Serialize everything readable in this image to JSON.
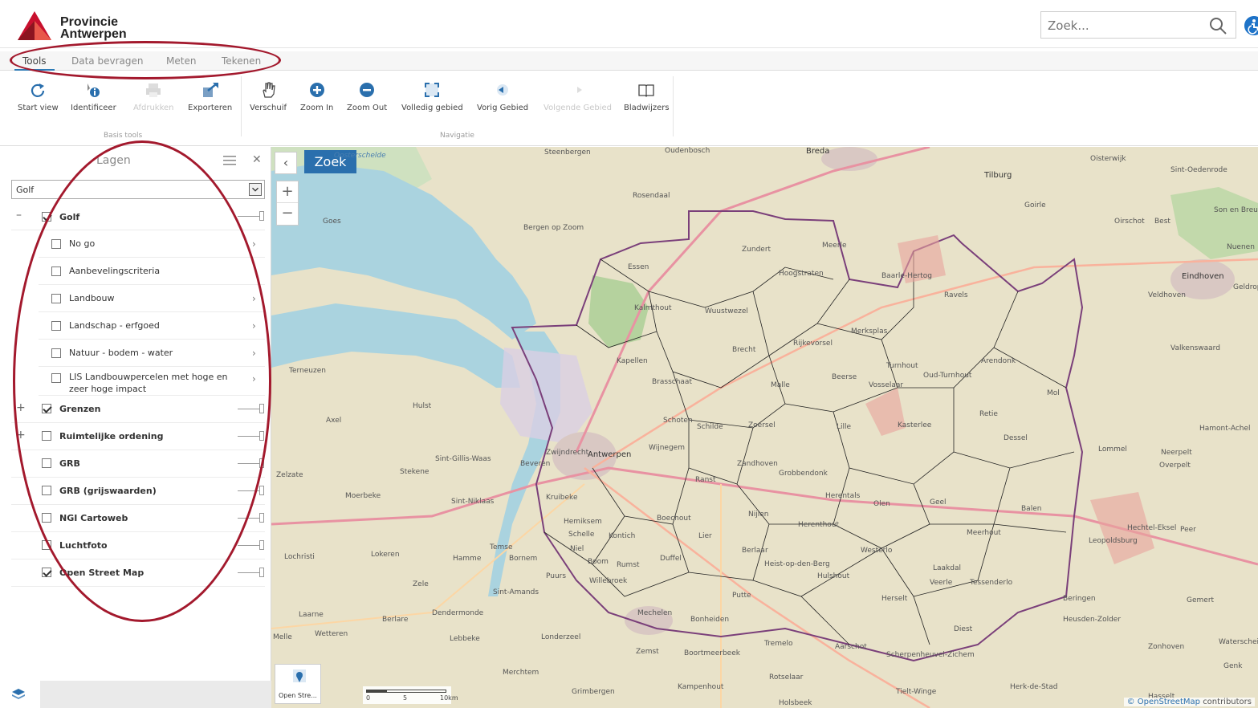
{
  "header": {
    "brand_line1": "Provincie",
    "brand_line2": "Antwerpen",
    "search_placeholder": "Zoek..."
  },
  "tabs": [
    {
      "label": "Tools",
      "active": true
    },
    {
      "label": "Data bevragen",
      "active": false
    },
    {
      "label": "Meten",
      "active": false
    },
    {
      "label": "Tekenen",
      "active": false
    }
  ],
  "toolbar": {
    "basis_tools": [
      {
        "label": "Start view",
        "icon": "refresh-icon",
        "enabled": true
      },
      {
        "label": "Identificeer",
        "icon": "info-icon",
        "enabled": true
      },
      {
        "label": "Afdrukken",
        "icon": "printer-icon",
        "enabled": false
      },
      {
        "label": "Exporteren",
        "icon": "export-icon",
        "enabled": true
      }
    ],
    "basis_tools_label": "Basis tools",
    "navigatie": [
      {
        "label": "Verschuif",
        "icon": "hand-icon",
        "enabled": true
      },
      {
        "label": "Zoom In",
        "icon": "zoom-in-icon",
        "enabled": true
      },
      {
        "label": "Zoom Out",
        "icon": "zoom-out-icon",
        "enabled": true
      },
      {
        "label": "Volledig gebied",
        "icon": "full-extent-icon",
        "enabled": true
      },
      {
        "label": "Vorig Gebied",
        "icon": "back-arrow-icon",
        "enabled": true
      },
      {
        "label": "Volgende Gebied",
        "icon": "forward-arrow-icon",
        "enabled": false
      },
      {
        "label": "Bladwijzers",
        "icon": "book-icon",
        "enabled": true
      }
    ],
    "navigatie_label": "Navigatie"
  },
  "layers_panel": {
    "title": "Lagen",
    "selected_group": "Golf",
    "layers": [
      {
        "label": "Golf",
        "checked": true,
        "expander": "–",
        "bold": true
      },
      {
        "label": "Grenzen",
        "checked": true,
        "expander": "+",
        "bold": true
      },
      {
        "label": "Ruimtelijke ordening",
        "checked": false,
        "expander": "+",
        "bold": true
      },
      {
        "label": "GRB",
        "checked": false,
        "expander": "",
        "bold": true
      },
      {
        "label": "GRB (grijswaarden)",
        "checked": false,
        "expander": "",
        "bold": true
      },
      {
        "label": "NGI Cartoweb",
        "checked": false,
        "expander": "",
        "bold": true
      },
      {
        "label": "Luchtfoto",
        "checked": false,
        "expander": "",
        "bold": true
      },
      {
        "label": "Open Street Map",
        "checked": true,
        "expander": "",
        "bold": true
      }
    ],
    "golf_sublayers": [
      {
        "label": "No go",
        "checked": false
      },
      {
        "label": "Aanbevelingscriteria",
        "checked": false
      },
      {
        "label": "Landbouw",
        "checked": false
      },
      {
        "label": "Landschap - erfgoed",
        "checked": false
      },
      {
        "label": "Natuur - bodem - water",
        "checked": false
      },
      {
        "label": "LIS Landbouwpercelen met hoge en",
        "label2": "zeer hoge impact",
        "checked": false
      }
    ]
  },
  "map": {
    "search_button": "Zoek",
    "basemap_label": "Open Stre...",
    "scale_labels": [
      "0",
      "5",
      "10km"
    ],
    "attribution_link": "© OpenStreetMap",
    "attribution_text": "contributors",
    "place_labels": [
      "Oosterschelde",
      "Steenbergen",
      "Oudenbosch",
      "Breda",
      "Tilburg",
      "Oisterwijk",
      "Goes",
      "Bergen op Zoom",
      "Rosendaal",
      "Zundert",
      "Essen",
      "Hoogstraten",
      "Baarle-Hertog",
      "Ravels",
      "Meerle",
      "Wuustwezel",
      "Kalmthout",
      "Brecht",
      "Rijkevorsel",
      "Merksplas",
      "Turnhout",
      "Oud-Turnhout",
      "Arendonk",
      "Beerse",
      "Vosselaar",
      "Kapellen",
      "Brasschaat",
      "Schoten",
      "Malle",
      "Zoersel",
      "Lille",
      "Kasterlee",
      "Retie",
      "Dessel",
      "Mol",
      "Antwerpen",
      "Zwijndrecht",
      "Wijnegem",
      "Schilde",
      "Ranst",
      "Zandhoven",
      "Grobbendonk",
      "Herentals",
      "Olen",
      "Geel",
      "Balen",
      "Kruibeke",
      "Hemiksem",
      "Boechout",
      "Lier",
      "Nijlen",
      "Herenthout",
      "Meerhout",
      "Schelle",
      "Kontich",
      "Niel",
      "Boom",
      "Rumst",
      "Duffel",
      "Berlaar",
      "Heist-op-den-Berg",
      "Westerlo",
      "Laakdal",
      "Bornem",
      "Puurs",
      "Willebroek",
      "Sint-Amands",
      "Mechelen",
      "Bonheiden",
      "Putte",
      "Hulshout",
      "Herselt",
      "Eindhoven",
      "Veldhoven",
      "Neerpelt",
      "Overpelt",
      "Lommel",
      "Leopoldsburg",
      "Temse",
      "Hamme",
      "Zele",
      "Sint-Niklaas",
      "Beveren",
      "Stekene",
      "Sint-Gillis-Waas",
      "Terneuzen",
      "Hulst",
      "Zelzate",
      "Axel",
      "Moerbeke",
      "Lochristi",
      "Lokeren",
      "Laarne",
      "Berlare",
      "Dendermonde",
      "Wetteren",
      "Melle",
      "Lebbeke",
      "Londerzeel",
      "Merchtem",
      "Grimbergen",
      "Zemst",
      "Boortmeerbeek",
      "Tremelo",
      "Aarschot",
      "Rotselaar",
      "Scherpenheuvel-Zichem",
      "Diest",
      "Herk-de-Stad",
      "Tielt-Winge",
      "Holsbeek",
      "Kampenhout",
      "Veerle",
      "Tessenderlo",
      "Beringen",
      "Heusden-Zolder",
      "Zonhoven",
      "Waterschei",
      "Genk",
      "Hasselt",
      "Hechtel-Eksel",
      "Peer",
      "Hamont-Achel",
      "Valkenswaard",
      "Gemert",
      "Nuenen",
      "Geldrop",
      "Sint-Oedenrode",
      "Son en Breugel",
      "Oirschot",
      "Best",
      "Goirle",
      "Westerlo"
    ]
  },
  "colors": {
    "accent": "#2a6fad",
    "annotation": "#a3192d",
    "logo_red": "#c8102e",
    "map_land": "#e8e2c9",
    "map_water": "#aad3df",
    "map_green": "#add19e"
  }
}
